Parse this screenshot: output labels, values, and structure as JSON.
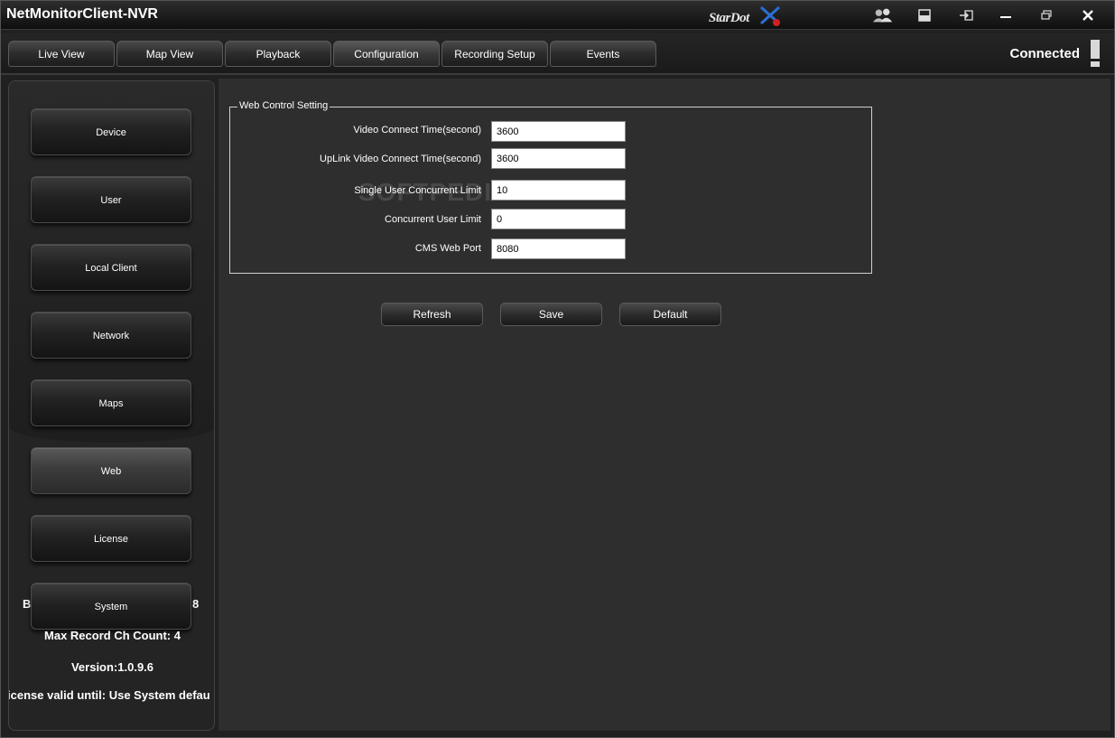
{
  "window": {
    "title": "NetMonitorClient-NVR",
    "logo_text": "STARDOT",
    "icons": [
      "users-icon",
      "layout-icon",
      "logout-icon",
      "minimize-icon",
      "restore-icon",
      "close-icon"
    ]
  },
  "tabs": [
    {
      "label": "Live View"
    },
    {
      "label": "Map View"
    },
    {
      "label": "Playback"
    },
    {
      "label": "Configuration",
      "active": true
    },
    {
      "label": "Recording Setup"
    },
    {
      "label": "Events"
    }
  ],
  "connection_status": "Connected",
  "sidebar": {
    "items": [
      {
        "label": "Device"
      },
      {
        "label": "User"
      },
      {
        "label": "Local Client"
      },
      {
        "label": "Network"
      },
      {
        "label": "Maps"
      },
      {
        "label": "Web",
        "active": true
      },
      {
        "label": "License"
      },
      {
        "label": "System"
      }
    ],
    "info": {
      "clipped_left": "B",
      "clipped_right": "8",
      "max_record": "Max Record Ch Count: 4",
      "version": "Version:1.0.9.6",
      "license": "icense valid until: Use System defau"
    }
  },
  "web_control": {
    "legend": "Web Control Setting",
    "fields": [
      {
        "label": "Video Connect Time(second)",
        "value": "3600"
      },
      {
        "label": "UpLink Video Connect Time(second)",
        "value": "3600"
      },
      {
        "label": "Single User Concurrent Limit",
        "value": "10"
      },
      {
        "label": "Concurrent User Limit",
        "value": "0"
      },
      {
        "label": "CMS Web Port",
        "value": "8080"
      }
    ],
    "watermark": "SOFTPEDIA"
  },
  "actions": {
    "refresh": "Refresh",
    "save": "Save",
    "default": "Default"
  },
  "colors": {
    "accent_blue": "#2a6fd6",
    "accent_red": "#d02020"
  }
}
